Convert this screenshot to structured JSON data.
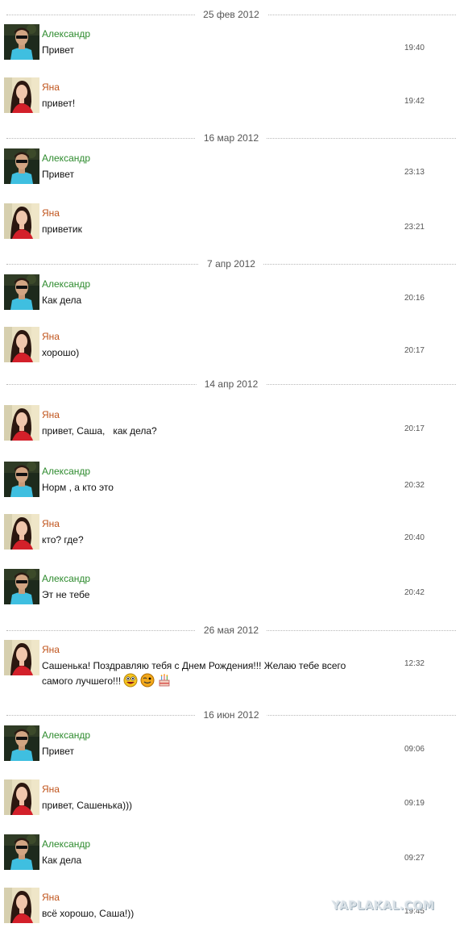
{
  "names": {
    "alex": "Александр",
    "yana": "Яна"
  },
  "colors": {
    "alex_name": "#2e8b2e",
    "yana_name": "#c0541c",
    "separator": "#b8b8b8"
  },
  "dates": {
    "d1": "25 фев 2012",
    "d2": "16 мар 2012",
    "d3": "7 апр 2012",
    "d4": "14 апр 2012",
    "d5": "26 мая 2012",
    "d6": "16 июн 2012"
  },
  "messages": {
    "m1": {
      "text": "Привет",
      "time": "19:40"
    },
    "m2": {
      "text": "привет!",
      "time": "19:42"
    },
    "m3": {
      "text": "Привет",
      "time": "23:13"
    },
    "m4": {
      "text": "приветик",
      "time": "23:21"
    },
    "m5": {
      "text": "Как дела",
      "time": "20:16"
    },
    "m6": {
      "text": "хорошо)",
      "time": "20:17"
    },
    "m7": {
      "text": "привет, Саша,   как дела?",
      "time": "20:17"
    },
    "m8": {
      "text": "Норм , а кто это",
      "time": "20:32"
    },
    "m9": {
      "text": "кто? где?",
      "time": "20:40"
    },
    "m10": {
      "text": "Эт не тебе",
      "time": "20:42"
    },
    "m11": {
      "text": "Сашенька! Поздравляю тебя с Днем Рождения!!! Желаю тебе всего самого лучшего!!!",
      "time": "12:32",
      "emoticons": [
        "laughing-emoticon-icon",
        "winking-emoticon-icon",
        "birthday-cake-icon"
      ]
    },
    "m12": {
      "text": "Привет",
      "time": "09:06"
    },
    "m13": {
      "text": "привет, Сашенька)))",
      "time": "09:19"
    },
    "m14": {
      "text": "Как дела",
      "time": "09:27"
    },
    "m15": {
      "text": "всё хорошо, Саша!))",
      "time": "19:45"
    }
  },
  "watermark": "YAPLAKAL.COM"
}
